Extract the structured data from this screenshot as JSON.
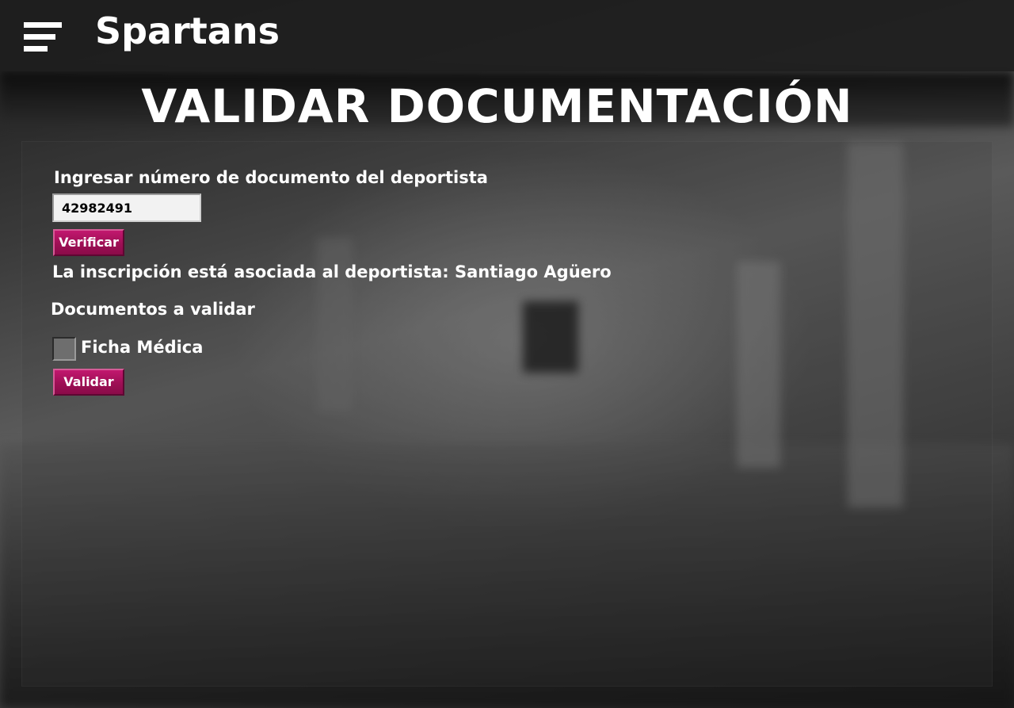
{
  "app": {
    "brand": "Spartans",
    "menu_icon": "hamburger-menu-icon"
  },
  "page": {
    "title": "VALIDAR DOCUMENTACIÓN"
  },
  "form": {
    "document_label": "Ingresar número de documento del deportista",
    "document_value": "42982491",
    "verify_label": "Verificar",
    "association_prefix": "La inscripción está asociada al deportista: ",
    "athlete_name": "Santiago Agüero",
    "documents_heading": "Documentos a validar",
    "documents": [
      {
        "label": "Ficha Médica",
        "checked": false
      }
    ],
    "validate_label": "Validar"
  },
  "colors": {
    "button_primary": "#9e0f55",
    "text": "#ffffff",
    "topbar": "#1e1e1e"
  }
}
